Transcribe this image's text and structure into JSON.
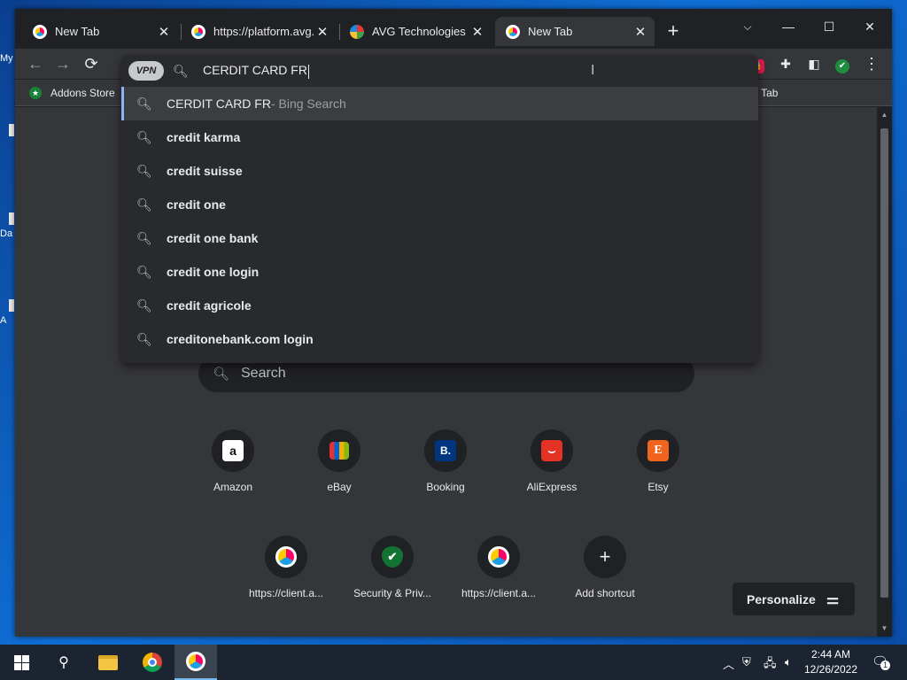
{
  "desktop": {
    "icons": [
      {
        "label": "My"
      },
      {
        "label": "Da"
      },
      {
        "label": "A"
      }
    ]
  },
  "tabs": [
    {
      "title": "New Tab",
      "close": "✕"
    },
    {
      "title": "https://platform.avg.c",
      "close": "✕"
    },
    {
      "title": "AVG Technologies On",
      "close": "✕"
    },
    {
      "title": "New Tab",
      "close": "✕"
    }
  ],
  "window_controls": {
    "dropdown": "⌵",
    "minimize": "—",
    "maximize": "☐",
    "close": "✕"
  },
  "new_tab_symbol": "+",
  "toolbar": {
    "back": "←",
    "forward": "→",
    "reload": "⟳",
    "menu": "⋮"
  },
  "omnibox": {
    "vpn_label": "VPN",
    "query": "CERDIT CARD FR"
  },
  "suggestions": [
    {
      "bold": "",
      "text": "CERDIT CARD FR",
      "suffix": " - Bing Search"
    },
    {
      "bold": "credit karma",
      "text": "",
      "suffix": ""
    },
    {
      "bold": "credit suisse",
      "text": "",
      "suffix": ""
    },
    {
      "bold": "credit one",
      "text": "",
      "suffix": ""
    },
    {
      "bold": "credit one bank",
      "text": "",
      "suffix": ""
    },
    {
      "bold": "credit one login",
      "text": "",
      "suffix": ""
    },
    {
      "bold": "credit agricole",
      "text": "",
      "suffix": ""
    },
    {
      "bold": "creditonebank.com login",
      "text": "",
      "suffix": ""
    }
  ],
  "bookmarks": [
    {
      "label": "Addons Store"
    },
    {
      "label": "New Tab"
    }
  ],
  "ntp": {
    "search_placeholder": "Search",
    "shortcuts_row1": [
      {
        "label": "Amazon",
        "glyph": "a",
        "color": "#ffffff"
      },
      {
        "label": "eBay",
        "glyph": "▮",
        "color": "#e53238"
      },
      {
        "label": "Booking",
        "glyph": "B.",
        "color": "#003580"
      },
      {
        "label": "AliExpress",
        "glyph": "⌣",
        "color": "#e43225"
      },
      {
        "label": "Etsy",
        "glyph": "E",
        "color": "#f1641e"
      }
    ],
    "shortcuts_row2": [
      {
        "label": "https://client.a...",
        "glyph": "",
        "color": "#1b9fe4"
      },
      {
        "label": "Security & Priv...",
        "glyph": "✔",
        "color": "#137333"
      },
      {
        "label": "https://client.a...",
        "glyph": "",
        "color": "#1b9fe4"
      },
      {
        "label": "Add shortcut",
        "glyph": "+",
        "color": "#202124"
      }
    ],
    "personalize": "Personalize"
  },
  "taskbar": {
    "time": "2:44 AM",
    "date": "12/26/2022",
    "notification_count": "1"
  },
  "colors": {
    "accent": "#8ab4f8",
    "window_bg": "#202124",
    "toolbar_bg": "#35363a"
  }
}
